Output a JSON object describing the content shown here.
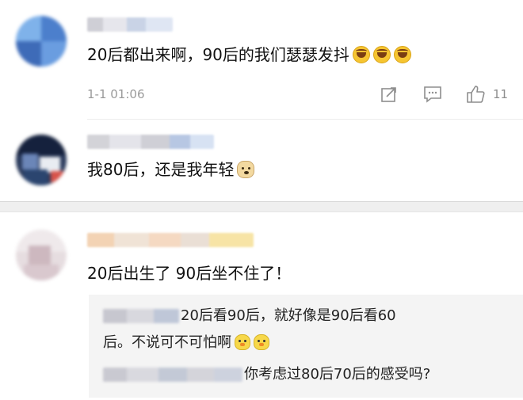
{
  "comments": [
    {
      "time": "1-1 01:06",
      "text": "20后都出来啊，90后的我们瑟瑟发抖",
      "like_count": "11",
      "emoji": "laughing-crying-icon"
    },
    {
      "text": "我80后，还是我年轻",
      "emoji": "doge-icon"
    },
    {
      "text": "20后出生了 90后坐不住了！",
      "replies": [
        {
          "text_line1": "20后看90后，就好像是90后看60",
          "text_line2": "后。不说可不可怕啊",
          "emoji": "chicken-icon"
        },
        {
          "text": "你考虑过80后70后的感受吗?"
        }
      ]
    }
  ],
  "icons": {
    "share": "share-icon",
    "reply": "reply-icon",
    "like": "thumbs-up-icon"
  },
  "colors": {
    "meta_gray": "#9a9a9a",
    "reply_bg": "#f4f4f4",
    "separator": "#efefef"
  }
}
